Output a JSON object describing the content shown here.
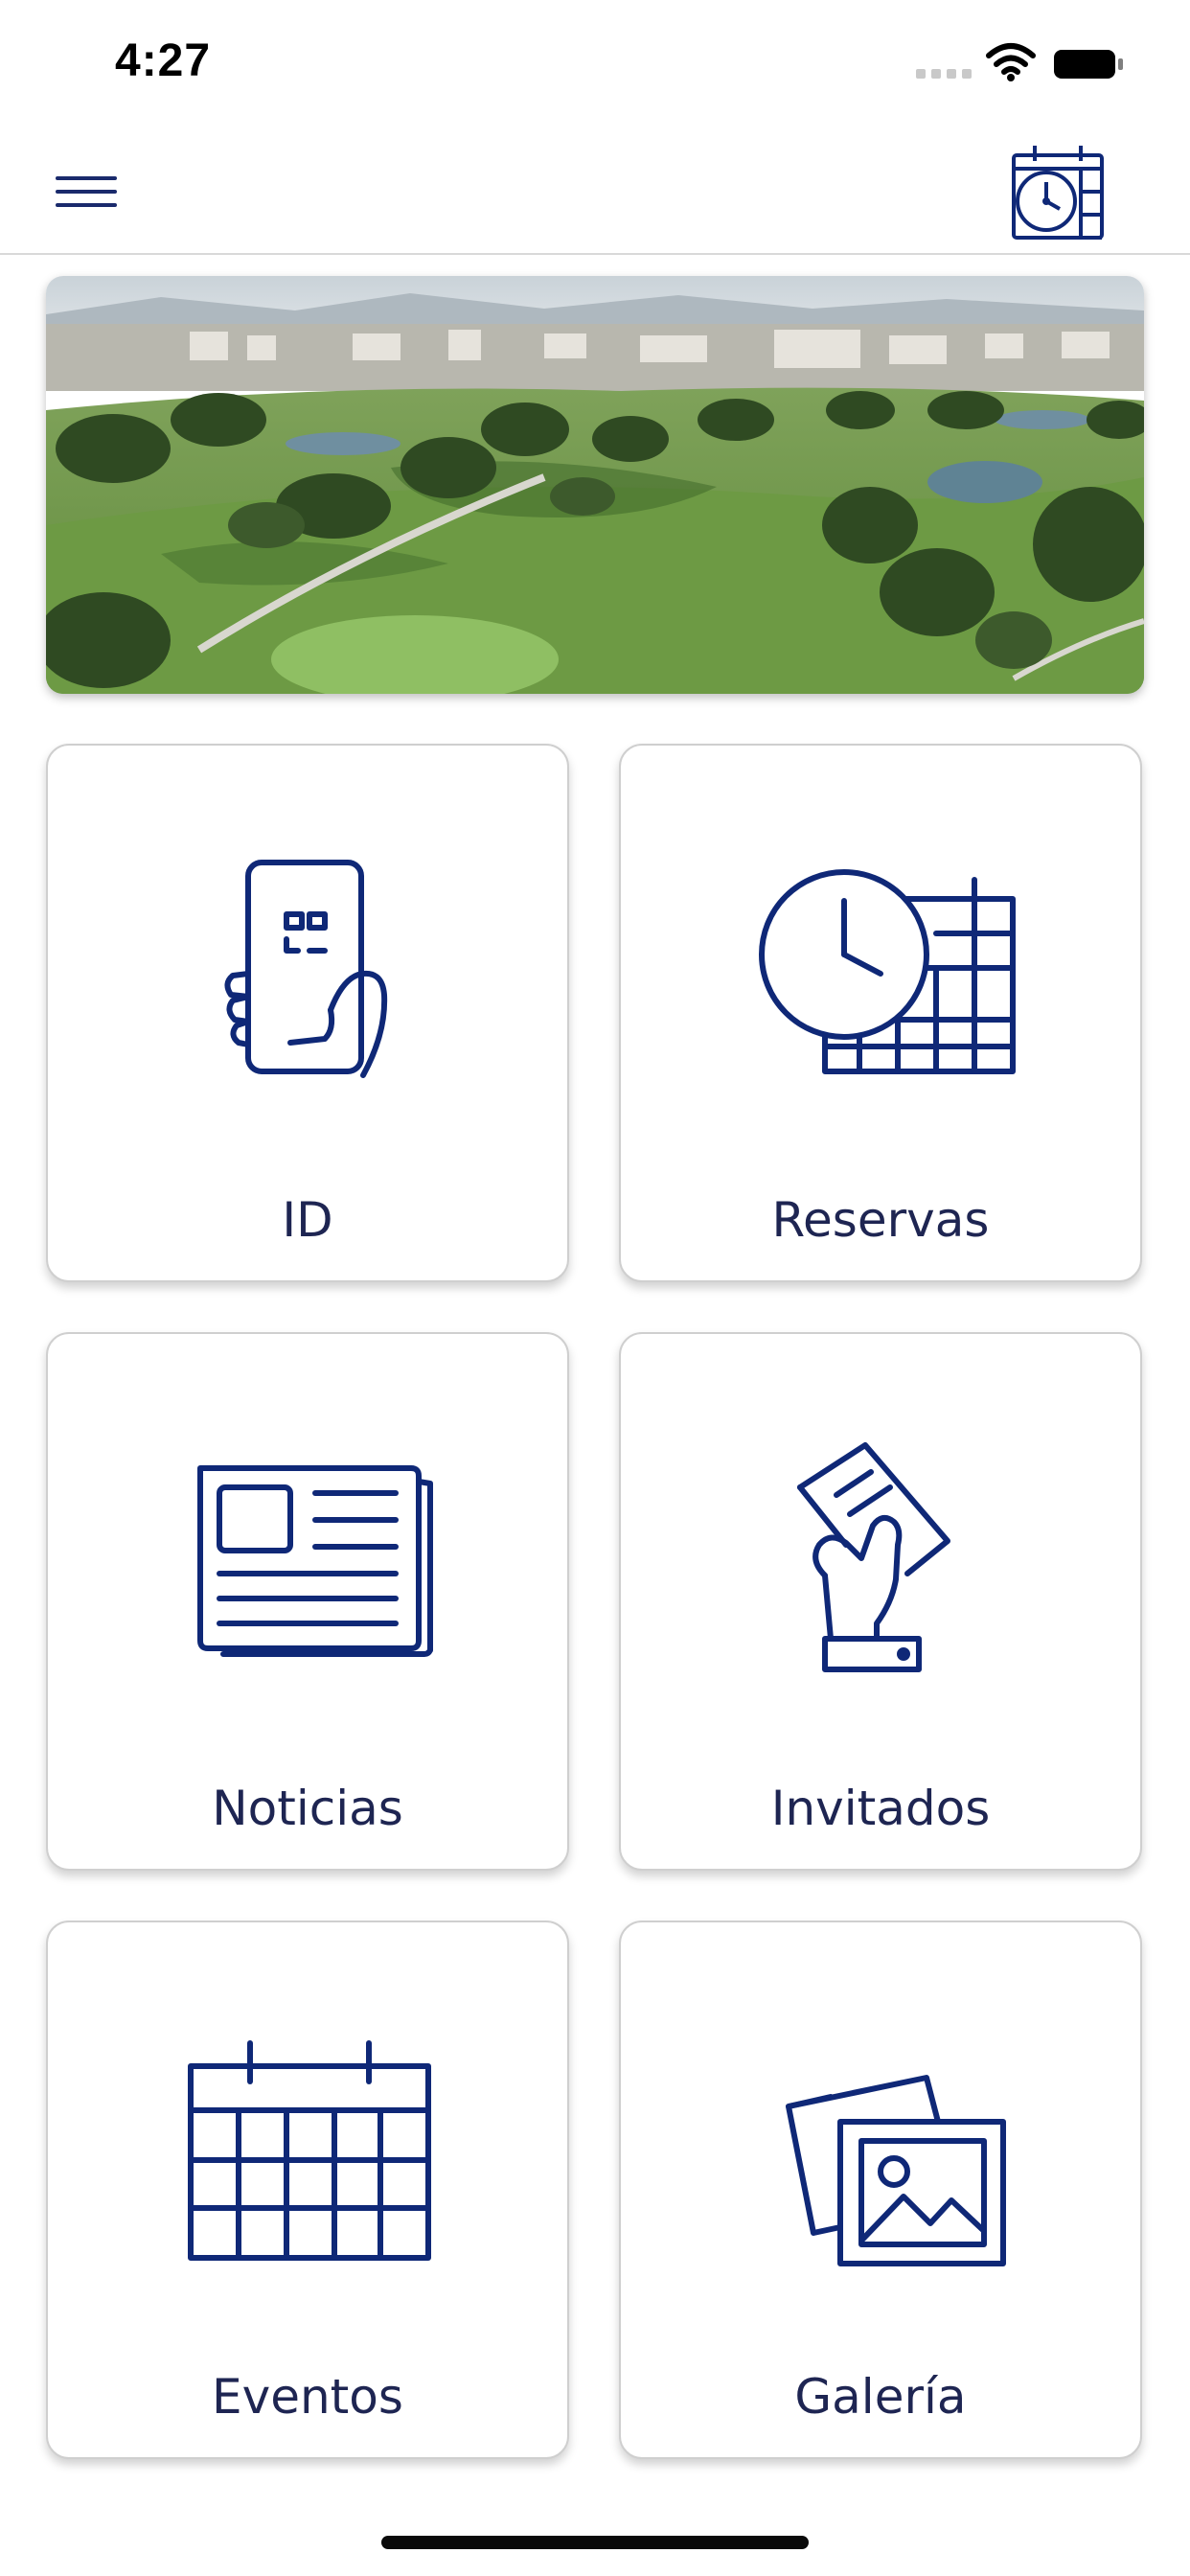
{
  "status_bar": {
    "time": "4:27"
  },
  "nav": {
    "menu_icon": "hamburger-menu-icon",
    "schedule_icon": "calendar-clock-icon"
  },
  "hero": {
    "image": "golf course aerial photo"
  },
  "tiles": [
    {
      "label": "ID",
      "icon": "phone-qr-code-icon"
    },
    {
      "label": "Reservas",
      "icon": "clock-calendar-icon"
    },
    {
      "label": "Noticias",
      "icon": "newspaper-icon"
    },
    {
      "label": "Invitados",
      "icon": "hand-ticket-icon"
    },
    {
      "label": "Eventos",
      "icon": "calendar-icon"
    },
    {
      "label": "Galería",
      "icon": "photo-gallery-icon"
    }
  ],
  "colors": {
    "icon_navy": "#0f2877",
    "label_text": "#1e2552",
    "tile_border": "#cfcfcf",
    "nav_divider": "#d9d9d9"
  }
}
